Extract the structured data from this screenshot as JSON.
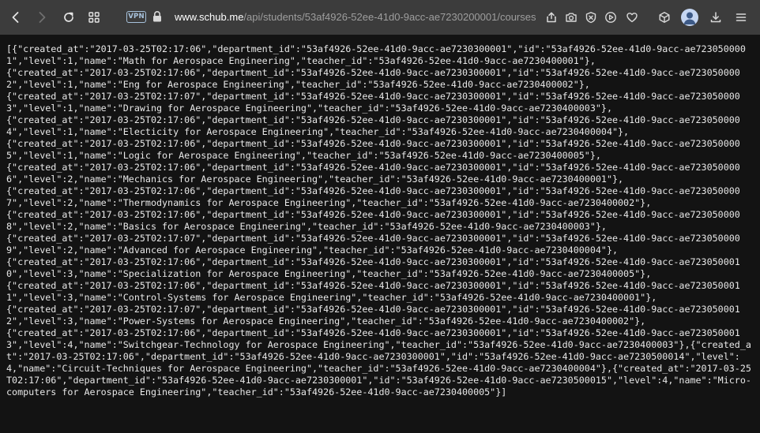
{
  "browser": {
    "vpn_label": "VPN",
    "url_host": "www.schub.me",
    "url_path": "/api/students/53af4926-52ee-41d0-9acc-ae7230200001/courses",
    "icons": {
      "back": "arrow-left-icon",
      "forward": "arrow-right-icon",
      "reload": "reload-icon",
      "tabs": "grid-icon",
      "lock": "lock-icon",
      "share": "share-icon",
      "screenshot": "camera-icon",
      "block": "shield-x-icon",
      "play": "play-icon",
      "favorite": "heart-icon",
      "extensions": "cube-icon",
      "profile": "avatar-icon",
      "download": "download-icon",
      "menu": "menu-icon"
    },
    "colors": {
      "toolbar_bg": "#3c3c3c",
      "page_bg": "#131313",
      "url_host": "#ffffff",
      "url_path": "#9e9e9e",
      "vpn": "#a7c2dc"
    }
  },
  "page": {
    "json_text": "[{\"created_at\":\"2017-03-25T02:17:06\",\"department_id\":\"53af4926-52ee-41d0-9acc-ae7230300001\",\"id\":\"53af4926-52ee-41d0-9acc-ae7230500001\",\"level\":1,\"name\":\"Math for Aerospace Engineering\",\"teacher_id\":\"53af4926-52ee-41d0-9acc-ae7230400001\"},\n{\"created_at\":\"2017-03-25T02:17:06\",\"department_id\":\"53af4926-52ee-41d0-9acc-ae7230300001\",\"id\":\"53af4926-52ee-41d0-9acc-ae7230500002\",\"level\":1,\"name\":\"Eng for Aerospace Engineering\",\"teacher_id\":\"53af4926-52ee-41d0-9acc-ae7230400002\"},\n{\"created_at\":\"2017-03-25T02:17:07\",\"department_id\":\"53af4926-52ee-41d0-9acc-ae7230300001\",\"id\":\"53af4926-52ee-41d0-9acc-ae7230500003\",\"level\":1,\"name\":\"Drawing for Aerospace Engineering\",\"teacher_id\":\"53af4926-52ee-41d0-9acc-ae7230400003\"},\n{\"created_at\":\"2017-03-25T02:17:06\",\"department_id\":\"53af4926-52ee-41d0-9acc-ae7230300001\",\"id\":\"53af4926-52ee-41d0-9acc-ae7230500004\",\"level\":1,\"name\":\"Electicity for Aerospace Engineering\",\"teacher_id\":\"53af4926-52ee-41d0-9acc-ae7230400004\"},\n{\"created_at\":\"2017-03-25T02:17:06\",\"department_id\":\"53af4926-52ee-41d0-9acc-ae7230300001\",\"id\":\"53af4926-52ee-41d0-9acc-ae7230500005\",\"level\":1,\"name\":\"Logic for Aerospace Engineering\",\"teacher_id\":\"53af4926-52ee-41d0-9acc-ae7230400005\"},\n{\"created_at\":\"2017-03-25T02:17:06\",\"department_id\":\"53af4926-52ee-41d0-9acc-ae7230300001\",\"id\":\"53af4926-52ee-41d0-9acc-ae7230500006\",\"level\":2,\"name\":\"Mechanics for Aerospace Engineering\",\"teacher_id\":\"53af4926-52ee-41d0-9acc-ae7230400001\"},\n{\"created_at\":\"2017-03-25T02:17:06\",\"department_id\":\"53af4926-52ee-41d0-9acc-ae7230300001\",\"id\":\"53af4926-52ee-41d0-9acc-ae7230500007\",\"level\":2,\"name\":\"Thermodynamics for Aerospace Engineering\",\"teacher_id\":\"53af4926-52ee-41d0-9acc-ae7230400002\"},\n{\"created_at\":\"2017-03-25T02:17:06\",\"department_id\":\"53af4926-52ee-41d0-9acc-ae7230300001\",\"id\":\"53af4926-52ee-41d0-9acc-ae7230500008\",\"level\":2,\"name\":\"Basics for Aerospace Engineering\",\"teacher_id\":\"53af4926-52ee-41d0-9acc-ae7230400003\"},\n{\"created_at\":\"2017-03-25T02:17:07\",\"department_id\":\"53af4926-52ee-41d0-9acc-ae7230300001\",\"id\":\"53af4926-52ee-41d0-9acc-ae7230500009\",\"level\":2,\"name\":\"Advanced for Aerospace Engineering\",\"teacher_id\":\"53af4926-52ee-41d0-9acc-ae7230400004\"},\n{\"created_at\":\"2017-03-25T02:17:06\",\"department_id\":\"53af4926-52ee-41d0-9acc-ae7230300001\",\"id\":\"53af4926-52ee-41d0-9acc-ae7230500010\",\"level\":3,\"name\":\"Specialization for Aerospace Engineering\",\"teacher_id\":\"53af4926-52ee-41d0-9acc-ae7230400005\"},\n{\"created_at\":\"2017-03-25T02:17:06\",\"department_id\":\"53af4926-52ee-41d0-9acc-ae7230300001\",\"id\":\"53af4926-52ee-41d0-9acc-ae7230500011\",\"level\":3,\"name\":\"Control-Systems for Aerospace Engineering\",\"teacher_id\":\"53af4926-52ee-41d0-9acc-ae7230400001\"},\n{\"created_at\":\"2017-03-25T02:17:07\",\"department_id\":\"53af4926-52ee-41d0-9acc-ae7230300001\",\"id\":\"53af4926-52ee-41d0-9acc-ae7230500012\",\"level\":3,\"name\":\"Power-Systems for Aerospace Engineering\",\"teacher_id\":\"53af4926-52ee-41d0-9acc-ae7230400002\"},\n{\"created_at\":\"2017-03-25T02:17:06\",\"department_id\":\"53af4926-52ee-41d0-9acc-ae7230300001\",\"id\":\"53af4926-52ee-41d0-9acc-ae7230500013\",\"level\":4,\"name\":\"Switchgear-Technology for Aerospace Engineering\",\"teacher_id\":\"53af4926-52ee-41d0-9acc-ae7230400003\"},{\"created_at\":\"2017-03-25T02:17:06\",\"department_id\":\"53af4926-52ee-41d0-9acc-ae7230300001\",\"id\":\"53af4926-52ee-41d0-9acc-ae7230500014\",\"level\":4,\"name\":\"Circuit-Techniques for Aerospace Engineering\",\"teacher_id\":\"53af4926-52ee-41d0-9acc-ae7230400004\"},{\"created_at\":\"2017-03-25T02:17:06\",\"department_id\":\"53af4926-52ee-41d0-9acc-ae7230300001\",\"id\":\"53af4926-52ee-41d0-9acc-ae7230500015\",\"level\":4,\"name\":\"Micro-computers for Aerospace Engineering\",\"teacher_id\":\"53af4926-52ee-41d0-9acc-ae7230400005\"}]"
  }
}
